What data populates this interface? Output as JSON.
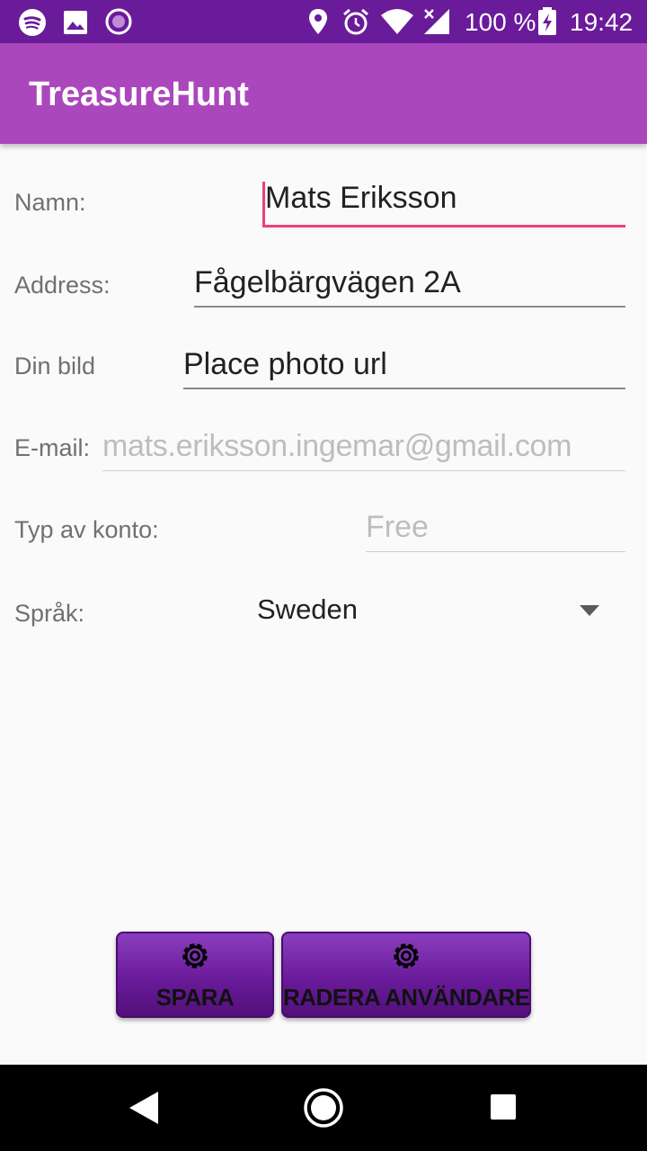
{
  "status_bar": {
    "battery": "100 %",
    "time": "19:42",
    "icons": [
      "spotify-icon",
      "image-icon",
      "circle-icon",
      "location-icon",
      "alarm-icon",
      "wifi-icon",
      "signal-icon",
      "battery-icon"
    ]
  },
  "app_bar": {
    "title": "TreasureHunt"
  },
  "form": {
    "name": {
      "label": "Namn:",
      "value": "Mats Eriksson"
    },
    "address": {
      "label": "Address:",
      "value": "Fågelbärgvägen 2A"
    },
    "photo": {
      "label": "Din bild",
      "value": "Place photo url"
    },
    "email": {
      "label": "E-mail:",
      "value": "mats.eriksson.ingemar@gmail.com"
    },
    "account_type": {
      "label": "Typ av konto:",
      "value": "Free"
    },
    "language": {
      "label": "Språk:",
      "selected": "Sweden"
    }
  },
  "buttons": {
    "save": {
      "label": "SPARA",
      "icon": "gear-icon"
    },
    "delete_user": {
      "label": "RADERA ANVÄNDARE",
      "icon": "gear-icon"
    }
  },
  "nav_bar": {
    "icons": [
      "back-icon",
      "home-icon",
      "recents-icon"
    ]
  },
  "colors": {
    "status_bar": "#6a1b9a",
    "app_bar": "#ab47bc",
    "accent": "#ec407a",
    "button": "#6a1b9a"
  }
}
